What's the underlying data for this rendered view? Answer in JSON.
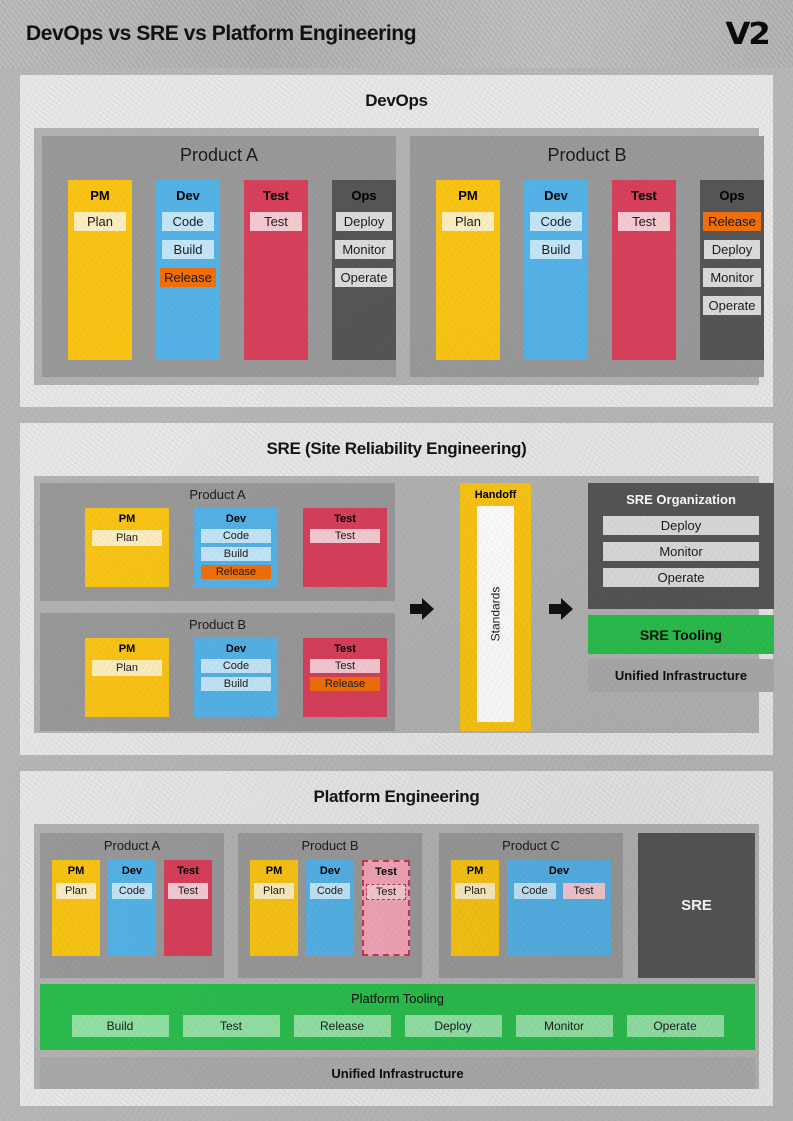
{
  "header": {
    "title": "DevOps vs SRE vs Platform Engineering",
    "logo": "V2"
  },
  "sections": {
    "devops": {
      "title": "DevOps",
      "products": [
        {
          "label": "Product A",
          "roles": [
            {
              "name": "PM",
              "items": [
                "Plan"
              ]
            },
            {
              "name": "Dev",
              "items": [
                "Code",
                "Build",
                "Release"
              ]
            },
            {
              "name": "Test",
              "items": [
                "Test"
              ]
            },
            {
              "name": "Ops",
              "items": [
                "Deploy",
                "Monitor",
                "Operate"
              ]
            }
          ]
        },
        {
          "label": "Product B",
          "roles": [
            {
              "name": "PM",
              "items": [
                "Plan"
              ]
            },
            {
              "name": "Dev",
              "items": [
                "Code",
                "Build"
              ]
            },
            {
              "name": "Test",
              "items": [
                "Test"
              ]
            },
            {
              "name": "Ops",
              "items": [
                "Release",
                "Deploy",
                "Monitor",
                "Operate"
              ]
            }
          ]
        }
      ]
    },
    "sre": {
      "title": "SRE (Site Reliability Engineering)",
      "products": [
        {
          "label": "Product A",
          "roles": [
            {
              "name": "PM",
              "items": [
                "Plan"
              ]
            },
            {
              "name": "Dev",
              "items": [
                "Code",
                "Build",
                "Release"
              ]
            },
            {
              "name": "Test",
              "items": [
                "Test"
              ]
            }
          ]
        },
        {
          "label": "Product B",
          "roles": [
            {
              "name": "PM",
              "items": [
                "Plan"
              ]
            },
            {
              "name": "Dev",
              "items": [
                "Code",
                "Build"
              ]
            },
            {
              "name": "Test",
              "items": [
                "Test",
                "Release"
              ]
            }
          ]
        }
      ],
      "handoff": {
        "title": "Handoff",
        "standards": "Standards"
      },
      "organization": {
        "title": "SRE Organization",
        "items": [
          "Deploy",
          "Monitor",
          "Operate"
        ]
      },
      "tooling": "SRE Tooling",
      "infrastructure": "Unified Infrastructure"
    },
    "platform": {
      "title": "Platform Engineering",
      "products": [
        {
          "label": "Product A",
          "roles": [
            {
              "name": "PM",
              "items": [
                "Plan"
              ]
            },
            {
              "name": "Dev",
              "items": [
                "Code"
              ]
            },
            {
              "name": "Test",
              "items": [
                "Test"
              ]
            }
          ]
        },
        {
          "label": "Product B",
          "roles": [
            {
              "name": "PM",
              "items": [
                "Plan"
              ]
            },
            {
              "name": "Dev",
              "items": [
                "Code"
              ]
            },
            {
              "name": "Test",
              "items": [
                "Test"
              ]
            }
          ]
        },
        {
          "label": "Product C",
          "roles": [
            {
              "name": "PM",
              "items": [
                "Plan"
              ]
            },
            {
              "name": "Dev",
              "items": [
                "Code",
                "Test"
              ]
            }
          ]
        }
      ],
      "sre_box": "SRE",
      "tooling": {
        "title": "Platform Tooling",
        "items": [
          "Build",
          "Test",
          "Release",
          "Deploy",
          "Monitor",
          "Operate"
        ]
      },
      "infrastructure": "Unified Infrastructure"
    }
  },
  "colors": {
    "pm": "#FBC515",
    "dev": "#55B3E8",
    "test": "#D9405C",
    "ops": "#565656",
    "green": "#2CBE4E",
    "gray": "#ABABAB",
    "release": "#F2700A",
    "dashed_border": "#C03A52"
  }
}
